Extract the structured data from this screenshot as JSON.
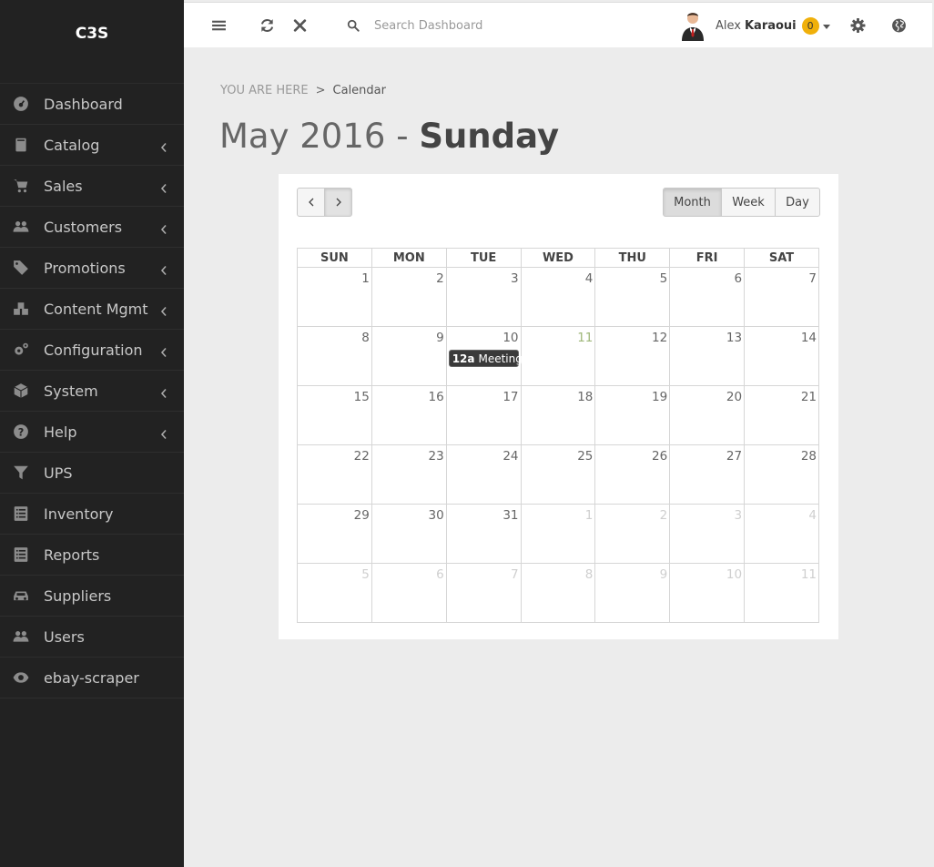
{
  "app": {
    "brand": "C3S"
  },
  "sidebar": {
    "items": [
      {
        "label": "Dashboard",
        "icon": "dashboard-icon",
        "chevron": false
      },
      {
        "label": "Catalog",
        "icon": "book-icon",
        "chevron": true
      },
      {
        "label": "Sales",
        "icon": "cart-icon",
        "chevron": true
      },
      {
        "label": "Customers",
        "icon": "users-icon",
        "chevron": true
      },
      {
        "label": "Promotions",
        "icon": "tags-icon",
        "chevron": true
      },
      {
        "label": "Content Mgmt",
        "icon": "cubes-icon",
        "chevron": true
      },
      {
        "label": "Configuration",
        "icon": "cogs-icon",
        "chevron": true
      },
      {
        "label": "System",
        "icon": "cube-icon",
        "chevron": true
      },
      {
        "label": "Help",
        "icon": "question-icon",
        "chevron": true
      },
      {
        "label": "UPS",
        "icon": "filter-icon",
        "chevron": false
      },
      {
        "label": "Inventory",
        "icon": "list-icon",
        "chevron": false
      },
      {
        "label": "Reports",
        "icon": "list-icon",
        "chevron": false
      },
      {
        "label": "Suppliers",
        "icon": "car-icon",
        "chevron": false
      },
      {
        "label": "Users",
        "icon": "users-icon",
        "chevron": false
      },
      {
        "label": "ebay-scraper",
        "icon": "eye-icon",
        "chevron": false
      }
    ]
  },
  "topbar": {
    "search_placeholder": "Search Dashboard",
    "user_first": "Alex",
    "user_last": "Karaoui",
    "notification_count": "0"
  },
  "breadcrumb": {
    "root": "YOU ARE HERE",
    "separator": ">",
    "current": "Calendar"
  },
  "page_title": {
    "month_year": "May 2016",
    "dash": "-",
    "day": "Sunday"
  },
  "calendar": {
    "views": {
      "month": "Month",
      "week": "Week",
      "day": "Day",
      "active": "Month"
    },
    "weekdays": [
      "SUN",
      "MON",
      "TUE",
      "WED",
      "THU",
      "FRI",
      "SAT"
    ],
    "weeks": [
      [
        {
          "d": "1"
        },
        {
          "d": "2"
        },
        {
          "d": "3"
        },
        {
          "d": "4"
        },
        {
          "d": "5"
        },
        {
          "d": "6"
        },
        {
          "d": "7"
        }
      ],
      [
        {
          "d": "8"
        },
        {
          "d": "9"
        },
        {
          "d": "10",
          "event": {
            "time": "12a",
            "title": "Meeting"
          }
        },
        {
          "d": "11",
          "green": true
        },
        {
          "d": "12"
        },
        {
          "d": "13"
        },
        {
          "d": "14"
        }
      ],
      [
        {
          "d": "15"
        },
        {
          "d": "16"
        },
        {
          "d": "17"
        },
        {
          "d": "18"
        },
        {
          "d": "19"
        },
        {
          "d": "20"
        },
        {
          "d": "21"
        }
      ],
      [
        {
          "d": "22"
        },
        {
          "d": "23"
        },
        {
          "d": "24"
        },
        {
          "d": "25"
        },
        {
          "d": "26"
        },
        {
          "d": "27"
        },
        {
          "d": "28"
        }
      ],
      [
        {
          "d": "29"
        },
        {
          "d": "30"
        },
        {
          "d": "31"
        },
        {
          "d": "1",
          "other": true
        },
        {
          "d": "2",
          "other": true
        },
        {
          "d": "3",
          "other": true
        },
        {
          "d": "4",
          "other": true
        }
      ],
      [
        {
          "d": "5",
          "other": true
        },
        {
          "d": "6",
          "other": true
        },
        {
          "d": "7",
          "other": true
        },
        {
          "d": "8",
          "other": true
        },
        {
          "d": "9",
          "other": true
        },
        {
          "d": "10",
          "other": true
        },
        {
          "d": "11",
          "other": true
        }
      ]
    ]
  },
  "colors": {
    "sidebar_bg": "#222222",
    "badge": "#f0b00a",
    "content_bg": "#ececec",
    "event_bg": "#3a3a3a"
  }
}
